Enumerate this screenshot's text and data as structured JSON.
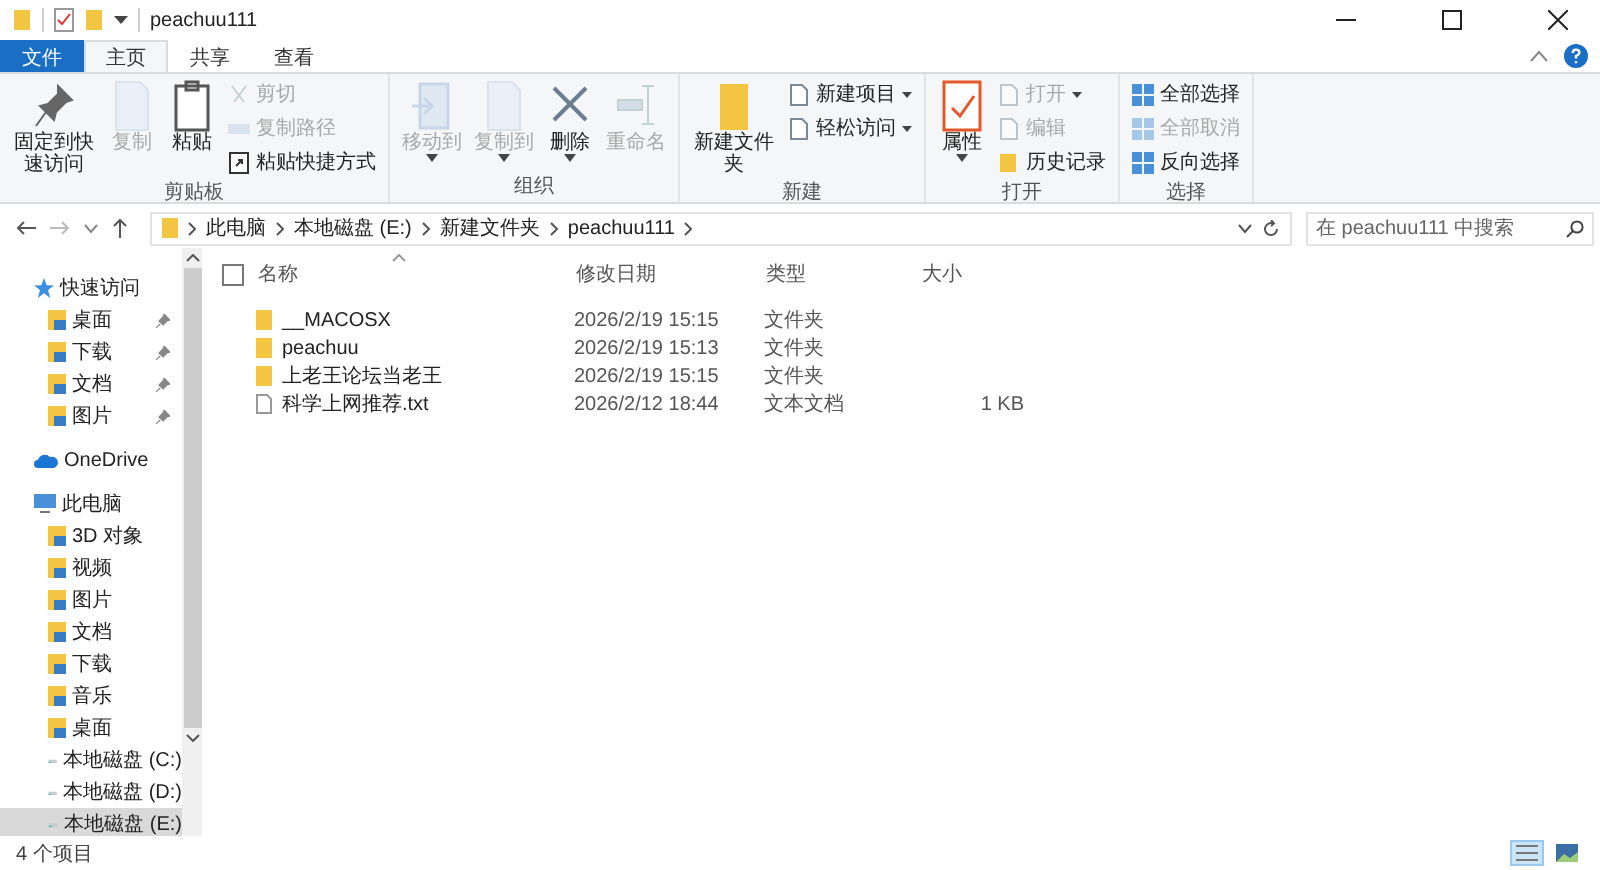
{
  "window": {
    "title": "peachuu111"
  },
  "tabs": [
    {
      "label": "文件",
      "kind": "file",
      "selected": false
    },
    {
      "label": "主页",
      "kind": "tab",
      "selected": true
    },
    {
      "label": "共享",
      "kind": "tab",
      "selected": false
    },
    {
      "label": "查看",
      "kind": "tab",
      "selected": false
    }
  ],
  "ribbon": {
    "groups": [
      {
        "label": "剪贴板",
        "items": [
          {
            "kind": "large",
            "label": "固定到快速访问",
            "disabled": false,
            "dropdown": false
          },
          {
            "kind": "large",
            "label": "复制",
            "disabled": true,
            "dropdown": false
          },
          {
            "kind": "large",
            "label": "粘贴",
            "disabled": false,
            "dropdown": false
          },
          {
            "kind": "small",
            "label": "剪切",
            "disabled": true,
            "dropdown": false
          },
          {
            "kind": "small",
            "label": "复制路径",
            "disabled": true,
            "dropdown": false
          },
          {
            "kind": "small",
            "label": "粘贴快捷方式",
            "disabled": false,
            "dropdown": false
          }
        ]
      },
      {
        "label": "组织",
        "items": [
          {
            "kind": "large",
            "label": "移动到",
            "disabled": true,
            "dropdown": true
          },
          {
            "kind": "large",
            "label": "复制到",
            "disabled": true,
            "dropdown": true
          },
          {
            "kind": "large",
            "label": "删除",
            "disabled": false,
            "dropdown": true
          },
          {
            "kind": "large",
            "label": "重命名",
            "disabled": true,
            "dropdown": false
          }
        ]
      },
      {
        "label": "新建",
        "items": [
          {
            "kind": "large",
            "label": "新建文件夹",
            "disabled": false,
            "dropdown": false
          },
          {
            "kind": "small",
            "label": "新建项目",
            "disabled": false,
            "dropdown": true
          },
          {
            "kind": "small",
            "label": "轻松访问",
            "disabled": false,
            "dropdown": true
          }
        ]
      },
      {
        "label": "打开",
        "items": [
          {
            "kind": "large",
            "label": "属性",
            "disabled": false,
            "dropdown": true
          },
          {
            "kind": "small",
            "label": "打开",
            "disabled": true,
            "dropdown": true
          },
          {
            "kind": "small",
            "label": "编辑",
            "disabled": true,
            "dropdown": false
          },
          {
            "kind": "small",
            "label": "历史记录",
            "disabled": false,
            "dropdown": false
          }
        ]
      },
      {
        "label": "选择",
        "items": [
          {
            "kind": "small",
            "label": "全部选择",
            "disabled": false,
            "dropdown": false
          },
          {
            "kind": "small",
            "label": "全部取消",
            "disabled": true,
            "dropdown": false
          },
          {
            "kind": "small",
            "label": "反向选择",
            "disabled": false,
            "dropdown": false
          }
        ]
      }
    ]
  },
  "address": {
    "path": [
      "此电脑",
      "本地磁盘 (E:)",
      "新建文件夹",
      "peachuu111"
    ]
  },
  "search": {
    "placeholder": "在 peachuu111 中搜索"
  },
  "sidebar": {
    "items": [
      {
        "label": "快速访问",
        "kind": "star",
        "selected": false,
        "children": [
          {
            "label": "桌面",
            "kind": "folder",
            "selected": false,
            "pinned": true
          },
          {
            "label": "下载",
            "kind": "folder",
            "selected": false,
            "pinned": true
          },
          {
            "label": "文档",
            "kind": "folder",
            "selected": false,
            "pinned": true
          },
          {
            "label": "图片",
            "kind": "folder",
            "selected": false,
            "pinned": true
          }
        ]
      },
      {
        "label": "OneDrive",
        "kind": "cloud",
        "selected": false
      },
      {
        "label": "此电脑",
        "kind": "pc",
        "selected": false,
        "children": [
          {
            "label": "3D 对象",
            "kind": "folder",
            "selected": false
          },
          {
            "label": "视频",
            "kind": "folder",
            "selected": false
          },
          {
            "label": "图片",
            "kind": "folder",
            "selected": false
          },
          {
            "label": "文档",
            "kind": "folder",
            "selected": false
          },
          {
            "label": "下载",
            "kind": "folder",
            "selected": false
          },
          {
            "label": "音乐",
            "kind": "folder",
            "selected": false
          },
          {
            "label": "桌面",
            "kind": "folder",
            "selected": false
          },
          {
            "label": "本地磁盘 (C:)",
            "kind": "drive",
            "selected": false
          },
          {
            "label": "本地磁盘 (D:)",
            "kind": "drive",
            "selected": false
          },
          {
            "label": "本地磁盘 (E:)",
            "kind": "drive",
            "selected": true
          }
        ]
      }
    ]
  },
  "table": {
    "select_all": {
      "checked": false
    },
    "columns": [
      "名称",
      "修改日期",
      "类型",
      "大小"
    ],
    "rows": [
      {
        "kind": "folder",
        "name": "__MACOSX",
        "date": "2026/2/19 15:15",
        "type": "文件夹",
        "size": ""
      },
      {
        "kind": "folder",
        "name": "peachuu",
        "date": "2026/2/19 15:13",
        "type": "文件夹",
        "size": ""
      },
      {
        "kind": "folder",
        "name": "上老王论坛当老王",
        "date": "2026/2/19 15:15",
        "type": "文件夹",
        "size": ""
      },
      {
        "kind": "file",
        "name": "科学上网推荐.txt",
        "date": "2026/2/12 18:44",
        "type": "文本文档",
        "size": "1 KB"
      }
    ]
  },
  "status_bar": {
    "text": "4 个项目",
    "views": [
      {
        "kind": "details",
        "selected": true
      },
      {
        "kind": "thumbnails",
        "selected": false
      }
    ]
  }
}
